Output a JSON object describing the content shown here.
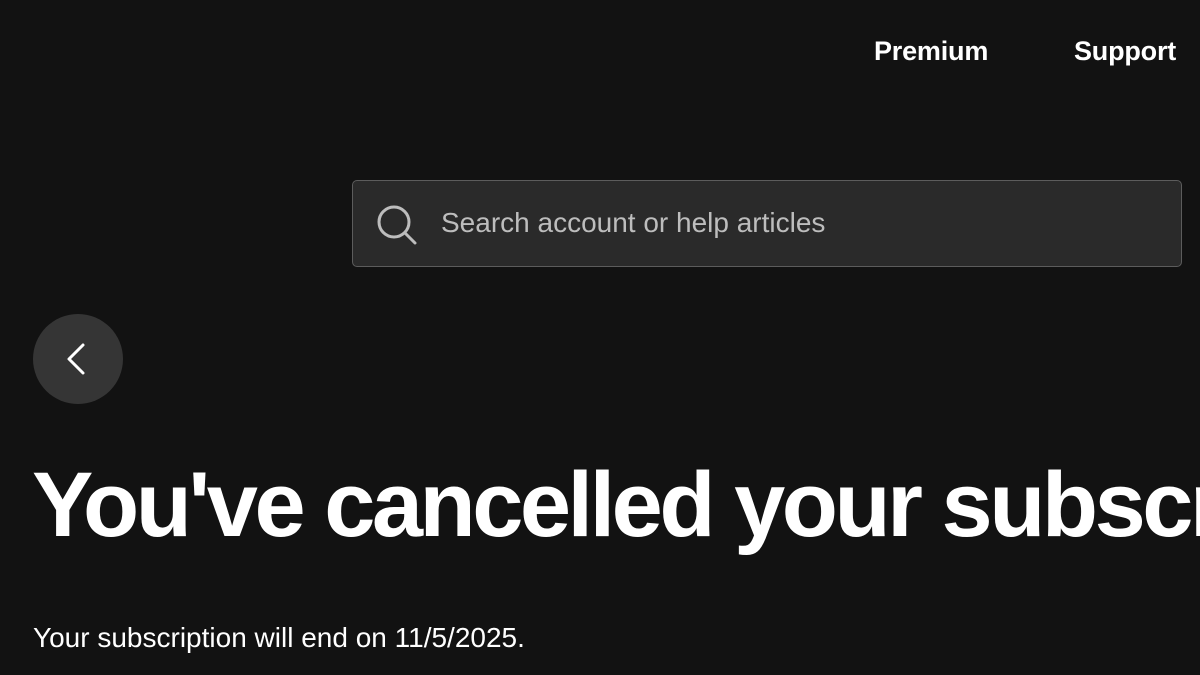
{
  "header": {
    "nav_items": [
      {
        "label": "Premium"
      },
      {
        "label": "Support"
      }
    ]
  },
  "search": {
    "placeholder": "Search account or help articles",
    "icon": "search-icon"
  },
  "back_button": {
    "icon": "chevron-left-icon"
  },
  "main": {
    "title": "You've cancelled your subscription",
    "message": "Your subscription will end on 11/5/2025."
  },
  "colors": {
    "background": "#121212",
    "search_background": "#2a2a2a",
    "search_border": "#5c5c5c",
    "back_button_background": "#353535",
    "text": "#ffffff",
    "placeholder": "#bdbdbd"
  }
}
